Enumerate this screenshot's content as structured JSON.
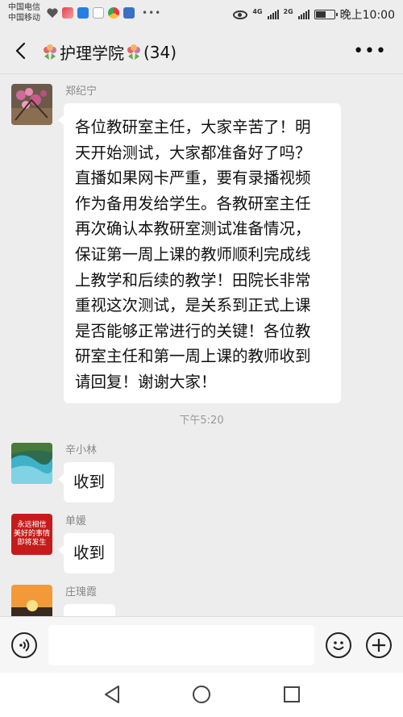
{
  "status_bar": {
    "carrier_1": "中国电信",
    "carrier_2": "中国移动",
    "network_1": "4G",
    "network_2": "2G",
    "time": "晚上10:00",
    "battery_level": 0.55
  },
  "header": {
    "title": "护理学院",
    "member_count": "(34)",
    "title_icon": "flower-icon",
    "back_icon": "chevron-left-icon",
    "menu_icon": "more-icon"
  },
  "messages": [
    {
      "sender": "郑纪宁",
      "lines": [
        "各位教研室主任，大家辛苦了！明",
        "天开始测试，大家都准备好了吗？",
        "直播如果网卡严重，要有录播视频",
        "作为备用发给学生。各教研室主任",
        "再次确认本教研室测试准备情况，",
        "保证第一周上课的教师顺利完成线",
        "上教学和后续的教学！田院长非常",
        "重视这次测试，是关系到正式上课",
        "是否能够正常进行的关键！各位教",
        "研室主任和第一周上课的教师收到",
        "请回复！谢谢大家！"
      ]
    },
    {
      "sender": "辛小林",
      "text": "收到"
    },
    {
      "sender": "单媛",
      "text": "收到",
      "avatar_text": [
        "永远相信",
        "美好的事情",
        "即将发生"
      ]
    },
    {
      "sender": "庄瑰霞",
      "text": ""
    }
  ],
  "timestamp": "下午5:20",
  "input": {
    "placeholder": ""
  }
}
